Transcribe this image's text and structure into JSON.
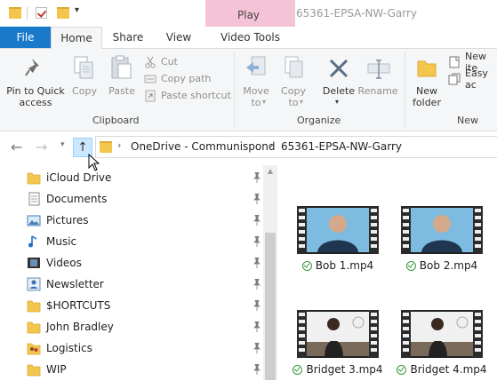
{
  "window": {
    "title": "65361-EPSA-NW-Garry",
    "contextual_tab_group": "Play"
  },
  "tabs": {
    "file": "File",
    "home": "Home",
    "share": "Share",
    "view": "View",
    "video_tools": "Video Tools"
  },
  "ribbon": {
    "clipboard": {
      "group_name": "Clipboard",
      "pin": [
        "Pin to Quick",
        "access"
      ],
      "copy": "Copy",
      "paste": "Paste",
      "cut": "Cut",
      "copy_path": "Copy path",
      "paste_shortcut": "Paste shortcut"
    },
    "organize": {
      "group_name": "Organize",
      "move_to": [
        "Move",
        "to"
      ],
      "copy_to": [
        "Copy",
        "to"
      ],
      "delete": "Delete",
      "rename": "Rename"
    },
    "new": {
      "group_name": "New",
      "new_folder": [
        "New",
        "folder"
      ],
      "new_item": "New ite",
      "easy_access": "Easy ac"
    }
  },
  "address": {
    "crumbs": [
      "OneDrive - Communispond",
      "65361-EPSA-NW-Garry"
    ]
  },
  "nav_pane": {
    "items": [
      {
        "label": "iCloud Drive",
        "icon": "folder-icon"
      },
      {
        "label": "Documents",
        "icon": "documents-icon"
      },
      {
        "label": "Pictures",
        "icon": "pictures-icon"
      },
      {
        "label": "Music",
        "icon": "music-icon"
      },
      {
        "label": "Videos",
        "icon": "videos-icon"
      },
      {
        "label": "Newsletter",
        "icon": "contact-icon"
      },
      {
        "label": "$HORTCUTS",
        "icon": "folder-icon"
      },
      {
        "label": "John Bradley",
        "icon": "folder-icon"
      },
      {
        "label": "Logistics",
        "icon": "people-folder-icon"
      },
      {
        "label": "WIP",
        "icon": "folder-icon"
      }
    ]
  },
  "files": [
    {
      "name": "Bob 1.mp4",
      "status": "synced"
    },
    {
      "name": "Bob 2.mp4",
      "status": "synced"
    },
    {
      "name": "Bridget 3.mp4",
      "status": "synced"
    },
    {
      "name": "Bridget 4.mp4",
      "status": "synced"
    }
  ],
  "colors": {
    "file_tab": "#1979ca",
    "context_tab": "#f4c3d6",
    "folder": "#f3c64d",
    "up_highlight": "#cce8ff"
  }
}
